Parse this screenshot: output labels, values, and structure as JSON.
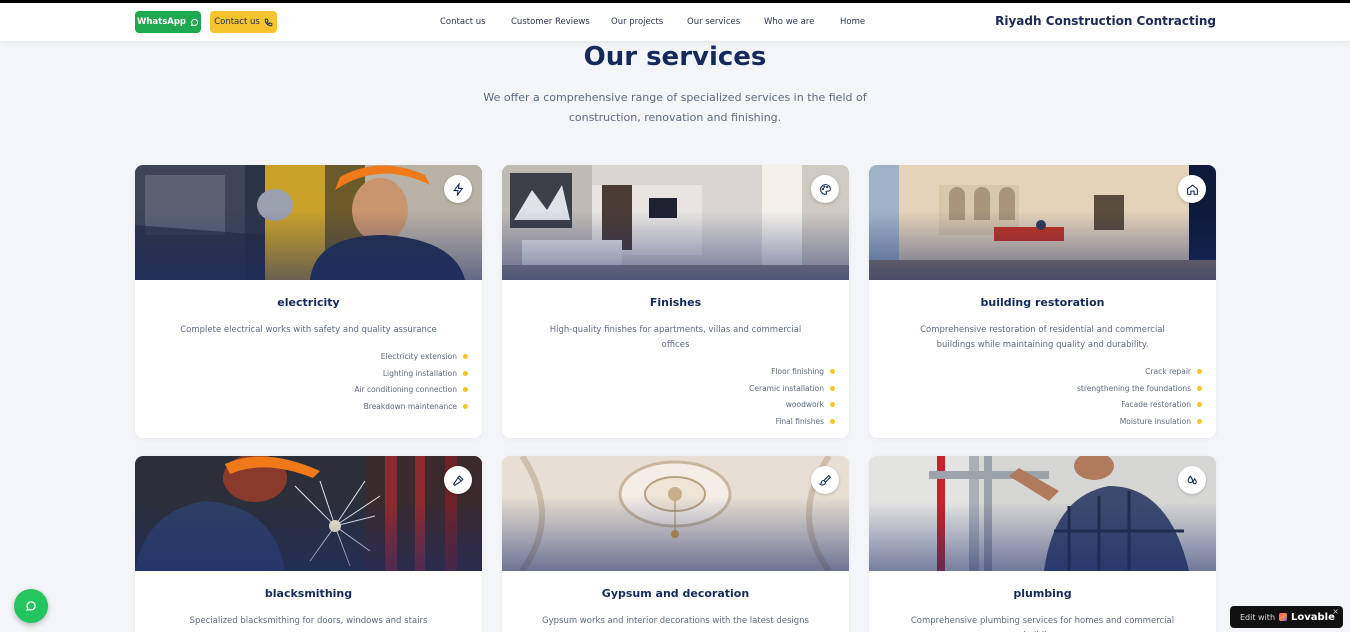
{
  "nav": {
    "whatsapp_label": "WhatsApp",
    "contact_label": "Contact us",
    "links": [
      "Contact us",
      "Customer Reviews",
      "Our projects",
      "Our services",
      "Who we are",
      "Home"
    ],
    "brand": "Riyadh Construction Contracting"
  },
  "section": {
    "title": "Our services",
    "subtitle": "We offer a comprehensive range of specialized services in the field of construction, renovation and finishing."
  },
  "cards": [
    {
      "title": "electricity",
      "icon": "bolt-icon",
      "description": "Complete electrical works with safety and quality assurance",
      "features": [
        "Electricity extension",
        "Lighting installation",
        "Air conditioning connection",
        "Breakdown maintenance"
      ]
    },
    {
      "title": "Finishes",
      "icon": "palette-icon",
      "description": "High-quality finishes for apartments, villas and commercial offices",
      "features": [
        "Floor finishing",
        "Ceramic installation",
        "woodwork",
        "Final finishes"
      ]
    },
    {
      "title": "building restoration",
      "icon": "home-icon",
      "description": "Comprehensive restoration of residential and commercial buildings while maintaining quality and durability.",
      "features": [
        "Crack repair",
        "strengthening the foundations",
        "Facade restoration",
        "Moisture insulation"
      ]
    },
    {
      "title": "blacksmithing",
      "icon": "hammer-icon",
      "description": "Specialized blacksmithing for doors, windows and stairs",
      "features": []
    },
    {
      "title": "Gypsum and decoration",
      "icon": "paintbrush-icon",
      "description": "Gypsum works and interior decorations with the latest designs",
      "features": []
    },
    {
      "title": "plumbing",
      "icon": "droplets-icon",
      "description": "Comprehensive plumbing services for homes and commercial buildings",
      "features": []
    }
  ],
  "badge": {
    "edit": "Edit with",
    "name": "Lovable",
    "close": "×"
  },
  "colors": {
    "primary": "#152a5c",
    "accent": "#f6c42c",
    "whatsapp": "#1fa84f"
  }
}
